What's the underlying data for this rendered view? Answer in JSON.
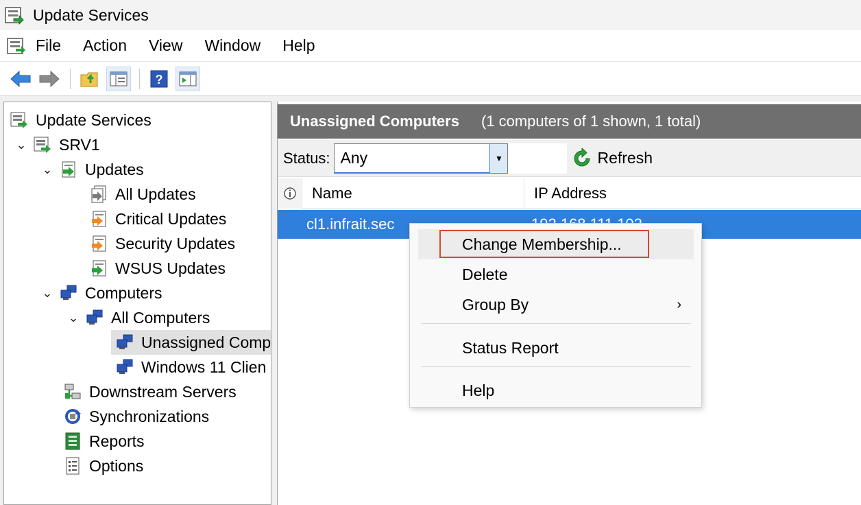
{
  "window": {
    "title": "Update Services"
  },
  "menu": {
    "items": [
      "File",
      "Action",
      "View",
      "Window",
      "Help"
    ]
  },
  "toolbar": {
    "icons": [
      "back-arrow-icon",
      "forward-arrow-icon",
      "up-folder-icon",
      "show-hide-tree-icon",
      "help-icon",
      "action-pane-icon"
    ]
  },
  "tree": {
    "items": [
      {
        "label": "Update Services",
        "icon": "update-services-icon"
      },
      {
        "label": "SRV1",
        "icon": "server-icon",
        "expanded": true
      },
      {
        "label": "Updates",
        "icon": "updates-icon",
        "expanded": true
      },
      {
        "label": "All Updates",
        "icon": "all-updates-icon"
      },
      {
        "label": "Critical Updates",
        "icon": "critical-updates-icon"
      },
      {
        "label": "Security Updates",
        "icon": "security-updates-icon"
      },
      {
        "label": "WSUS Updates",
        "icon": "wsus-updates-icon"
      },
      {
        "label": "Computers",
        "icon": "computers-icon",
        "expanded": true
      },
      {
        "label": "All Computers",
        "icon": "computers-icon",
        "expanded": true
      },
      {
        "label": "Unassigned Comp",
        "icon": "computers-icon",
        "selected": true
      },
      {
        "label": "Windows 11 Clien",
        "icon": "computers-icon"
      },
      {
        "label": "Downstream Servers",
        "icon": "downstream-servers-icon"
      },
      {
        "label": "Synchronizations",
        "icon": "synchronizations-icon"
      },
      {
        "label": "Reports",
        "icon": "reports-icon"
      },
      {
        "label": "Options",
        "icon": "options-icon"
      }
    ]
  },
  "main": {
    "header_title": "Unassigned Computers",
    "header_subtitle": "(1 computers of 1 shown, 1 total)",
    "status_label": "Status:",
    "status_value": "Any",
    "refresh_label": "Refresh",
    "columns": [
      "Name",
      "IP Address"
    ],
    "rows": [
      {
        "name": "cl1.infrait.sec",
        "ip": "192.168.111.102"
      }
    ]
  },
  "context_menu": {
    "items": [
      "Change Membership...",
      "Delete",
      "Group By",
      "Status Report",
      "Help"
    ],
    "highlighted": "Change Membership..."
  },
  "colors": {
    "selection": "#2f7fdc",
    "header": "#6f6f6f",
    "highlight_box": "#d9472e"
  }
}
